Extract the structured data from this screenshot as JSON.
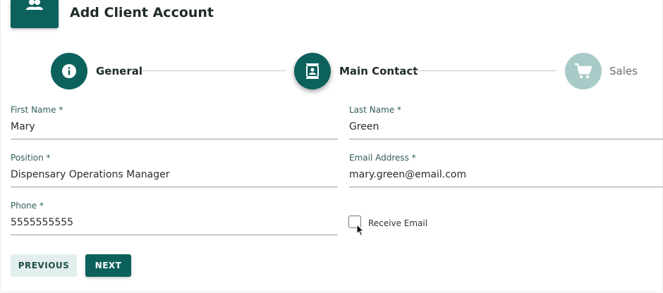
{
  "header": {
    "title": "Add Client Account",
    "icon": "people-icon"
  },
  "stepper": {
    "steps": [
      {
        "label": "General",
        "icon": "info-icon",
        "state": "completed"
      },
      {
        "label": "Main Contact",
        "icon": "contact-card-icon",
        "state": "active"
      },
      {
        "label": "Sales",
        "icon": "cart-icon",
        "state": "pending"
      }
    ]
  },
  "form": {
    "first_name": {
      "label": "First Name *",
      "value": "Mary"
    },
    "last_name": {
      "label": "Last Name *",
      "value": "Green"
    },
    "position": {
      "label": "Position *",
      "value": "Dispensary Operations Manager"
    },
    "email": {
      "label": "Email Address *",
      "value": "mary.green@email.com"
    },
    "phone": {
      "label": "Phone *",
      "value": "5555555555"
    },
    "receive_email": {
      "label": "Receive Email",
      "checked": false
    }
  },
  "actions": {
    "previous_label": "PREVIOUS",
    "next_label": "NEXT"
  },
  "colors": {
    "primary": "#0c615c",
    "pending_step": "#a9cbc8",
    "secondary_button_bg": "#e3efee",
    "label": "#2f5e5b"
  }
}
